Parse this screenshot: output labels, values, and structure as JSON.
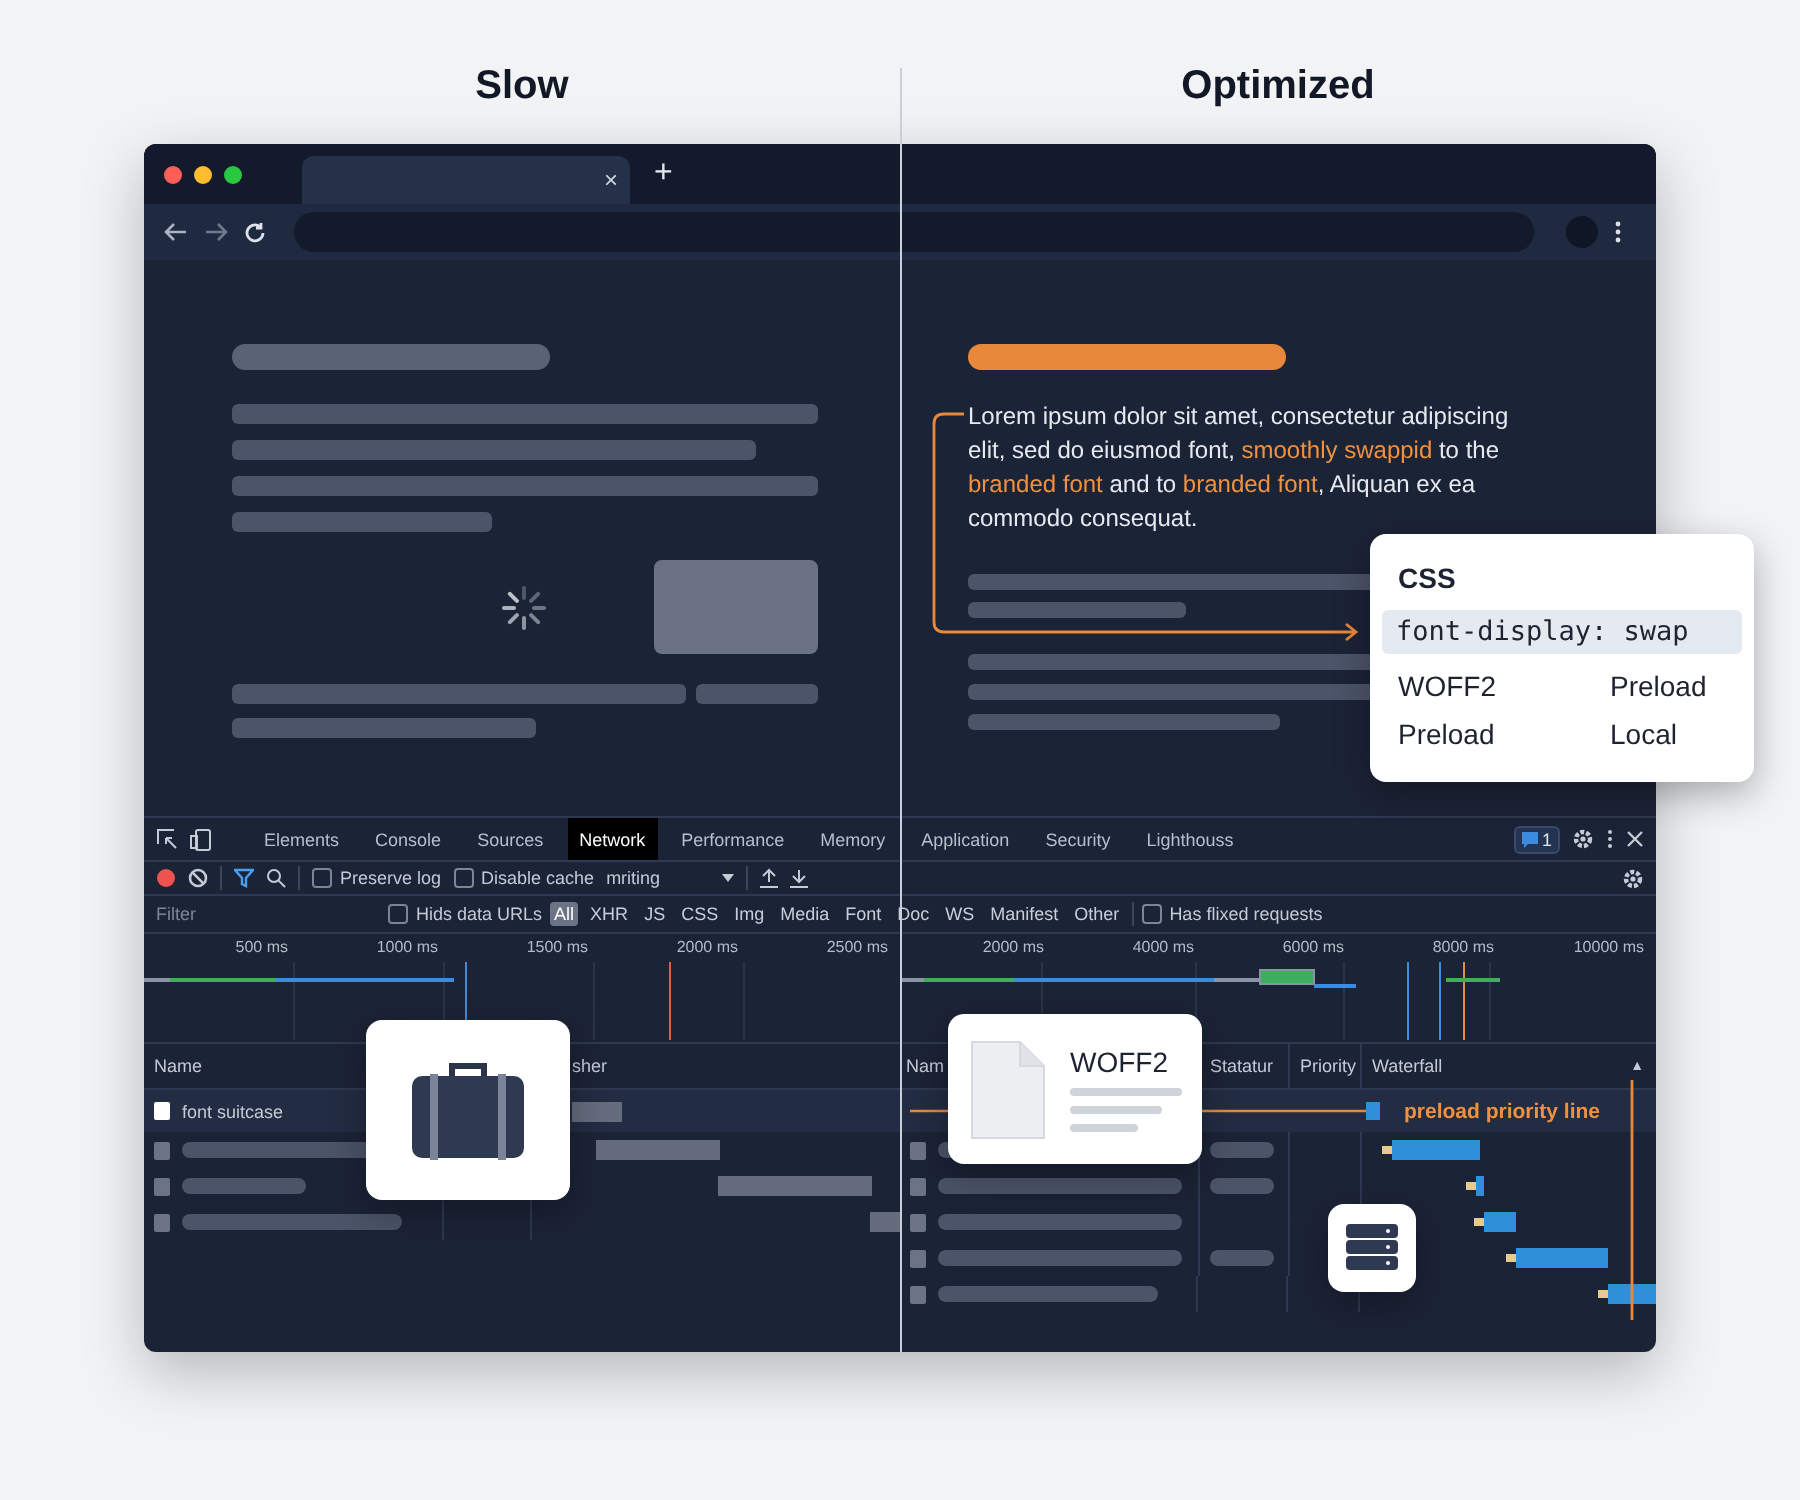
{
  "headings": [
    {
      "text": "Slow"
    },
    {
      "text": "Optimized"
    }
  ],
  "browser": {
    "tab_close": "×",
    "new_tab": "+"
  },
  "optimized_page": {
    "paragraph": [
      {
        "text": "Lorem ipsum dolor sit amet, consectetur adipiscing elit, sed do eiusmod font, ",
        "highlight": false
      },
      {
        "text": "smoothly swappid",
        "highlight": true
      },
      {
        "text": " to the ",
        "highlight": false
      },
      {
        "text": "branded font",
        "highlight": true
      },
      {
        "text": " and to ",
        "highlight": false
      },
      {
        "text": "branded font",
        "highlight": true
      },
      {
        "text": ", Aliquan ex ea commodo consequat.",
        "highlight": false
      }
    ]
  },
  "css_popup": {
    "title": "CSS",
    "code": "font-display: swap",
    "items": [
      "WOFF2",
      "Preload",
      "Preload",
      "Local"
    ]
  },
  "devtools": {
    "tabs": [
      {
        "label": "Elements",
        "selected": false
      },
      {
        "label": "Console",
        "selected": false
      },
      {
        "label": "Sources",
        "selected": false
      },
      {
        "label": "Network",
        "selected": true
      },
      {
        "label": "Performance",
        "selected": false
      },
      {
        "label": "Memory",
        "selected": false
      },
      {
        "label": "Application",
        "selected": false
      },
      {
        "label": "Security",
        "selected": false
      },
      {
        "label": "Lighthouss",
        "selected": false
      }
    ],
    "issues_badge": "1",
    "preserve_log": {
      "label": "Preserve log",
      "checked": false
    },
    "disable_cache": {
      "label": "Disable cache",
      "checked": false
    },
    "throttling": "mriting",
    "filter": {
      "placeholder": "Filter"
    },
    "hide_data_urls": {
      "label": "Hids data URLs",
      "checked": false
    },
    "type_filters": [
      {
        "label": "All",
        "selected": true
      },
      {
        "label": "XHR",
        "selected": false
      },
      {
        "label": "JS",
        "selected": false
      },
      {
        "label": "CSS",
        "selected": false
      },
      {
        "label": "Img",
        "selected": false
      },
      {
        "label": "Media",
        "selected": false
      },
      {
        "label": "Font",
        "selected": false
      },
      {
        "label": "Doc",
        "selected": false
      },
      {
        "label": "WS",
        "selected": false
      },
      {
        "label": "Manifest",
        "selected": false
      },
      {
        "label": "Other",
        "selected": false
      }
    ],
    "has_blocked": {
      "label": "Has flixed requests",
      "checked": false
    },
    "slow_timeline": {
      "ticks": [
        "500 ms",
        "1000 ms",
        "1500 ms",
        "2000 ms",
        "2500 ms"
      ]
    },
    "optimized_timeline": {
      "ticks": [
        "2000 ms",
        "4000 ms",
        "6000 ms",
        "8000 ms",
        "10000 ms"
      ]
    },
    "slow_table": {
      "columns": [
        "Name",
        "sher"
      ],
      "rows": [
        {
          "name": "font suitcase",
          "selected": true
        }
      ]
    },
    "optimized_table": {
      "columns": [
        "Nam",
        "Statatur",
        "Priority",
        "Waterfall"
      ],
      "sort_indicator": "▲",
      "annotation": "preload priority line"
    }
  },
  "woff2_card": {
    "label": "WOFF2"
  }
}
